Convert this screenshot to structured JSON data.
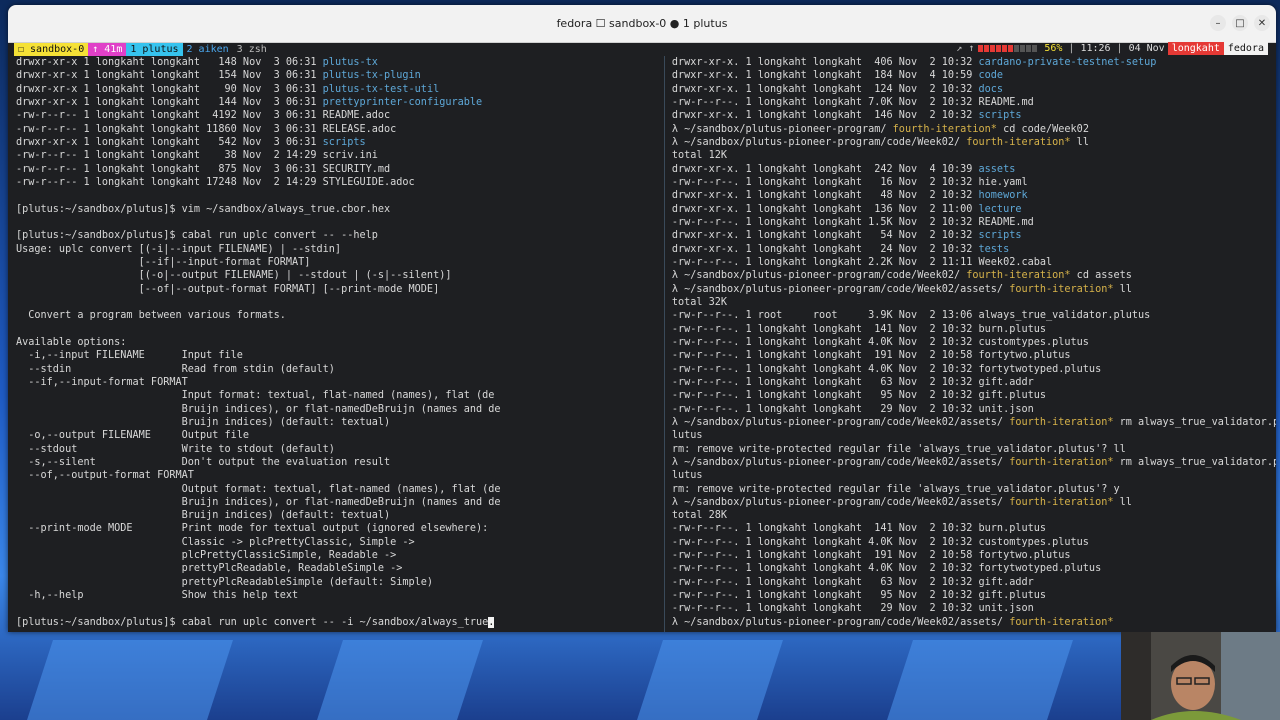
{
  "window": {
    "title": "fedora ☐ sandbox-0 ● 1 plutus",
    "buttons": [
      "–",
      "□",
      "✕"
    ]
  },
  "tmux": {
    "session": "☐ sandbox-0",
    "tabs": [
      {
        "label": "↑ 41m",
        "style": "pink"
      },
      {
        "label": "1 plutus",
        "style": "cyan"
      },
      {
        "label": "2 aiken",
        "style": "blue"
      },
      {
        "label": "3 zsh",
        "style": "gray"
      }
    ],
    "status": {
      "arrows": "↗ ↑",
      "battery": "56%",
      "battery_level": 0.56,
      "time": "11:26",
      "date": "04 Nov",
      "user": "longkaht",
      "host": "fedora"
    }
  },
  "left_pane": {
    "lines": [
      {
        "text": "drwxr-xr-x 1 longkaht longkaht   148 Nov  3 06:31 ",
        "link": "plutus-tx"
      },
      {
        "text": "drwxr-xr-x 1 longkaht longkaht   154 Nov  3 06:31 ",
        "link": "plutus-tx-plugin"
      },
      {
        "text": "drwxr-xr-x 1 longkaht longkaht    90 Nov  3 06:31 ",
        "link": "plutus-tx-test-util"
      },
      {
        "text": "drwxr-xr-x 1 longkaht longkaht   144 Nov  3 06:31 ",
        "link": "prettyprinter-configurable"
      },
      {
        "text": "-rw-r--r-- 1 longkaht longkaht  4192 Nov  3 06:31 README.adoc"
      },
      {
        "text": "-rw-r--r-- 1 longkaht longkaht 11860 Nov  3 06:31 RELEASE.adoc"
      },
      {
        "text": "drwxr-xr-x 1 longkaht longkaht   542 Nov  3 06:31 ",
        "link": "scripts"
      },
      {
        "text": "-rw-r--r-- 1 longkaht longkaht    38 Nov  2 14:29 scriv.ini"
      },
      {
        "text": "-rw-r--r-- 1 longkaht longkaht   875 Nov  3 06:31 SECURITY.md"
      },
      {
        "text": "-rw-r--r-- 1 longkaht longkaht 17248 Nov  2 14:29 STYLEGUIDE.adoc"
      },
      {
        "text": ""
      },
      {
        "text": "[plutus:~/sandbox/plutus]$ vim ~/sandbox/always_true.cbor.hex"
      },
      {
        "text": ""
      },
      {
        "text": "[plutus:~/sandbox/plutus]$ cabal run uplc convert -- --help"
      },
      {
        "text": "Usage: uplc convert [(-i|--input FILENAME) | --stdin]"
      },
      {
        "text": "                    [--if|--input-format FORMAT]"
      },
      {
        "text": "                    [(-o|--output FILENAME) | --stdout | (-s|--silent)]"
      },
      {
        "text": "                    [--of|--output-format FORMAT] [--print-mode MODE]"
      },
      {
        "text": ""
      },
      {
        "text": "  Convert a program between various formats."
      },
      {
        "text": ""
      },
      {
        "text": "Available options:"
      },
      {
        "text": "  -i,--input FILENAME      Input file"
      },
      {
        "text": "  --stdin                  Read from stdin (default)"
      },
      {
        "text": "  --if,--input-format FORMAT"
      },
      {
        "text": "                           Input format: textual, flat-named (names), flat (de"
      },
      {
        "text": "                           Bruijn indices), or flat-namedDeBruijn (names and de"
      },
      {
        "text": "                           Bruijn indices) (default: textual)"
      },
      {
        "text": "  -o,--output FILENAME     Output file"
      },
      {
        "text": "  --stdout                 Write to stdout (default)"
      },
      {
        "text": "  -s,--silent              Don't output the evaluation result"
      },
      {
        "text": "  --of,--output-format FORMAT"
      },
      {
        "text": "                           Output format: textual, flat-named (names), flat (de"
      },
      {
        "text": "                           Bruijn indices), or flat-namedDeBruijn (names and de"
      },
      {
        "text": "                           Bruijn indices) (default: textual)"
      },
      {
        "text": "  --print-mode MODE        Print mode for textual output (ignored elsewhere):"
      },
      {
        "text": "                           Classic -> plcPrettyClassic, Simple ->"
      },
      {
        "text": "                           plcPrettyClassicSimple, Readable ->"
      },
      {
        "text": "                           prettyPlcReadable, ReadableSimple ->"
      },
      {
        "text": "                           prettyPlcReadableSimple (default: Simple)"
      },
      {
        "text": "  -h,--help                Show this help text"
      },
      {
        "text": ""
      },
      {
        "text": "[plutus:~/sandbox/plutus]$ cabal run uplc convert -- -i ~/sandbox/always_true",
        "cursor": "."
      }
    ]
  },
  "right_pane": {
    "lines": [
      {
        "text": "drwxr-xr-x. 1 longkaht longkaht  406 Nov  2 10:32 ",
        "link": "cardano-private-testnet-setup"
      },
      {
        "text": "drwxr-xr-x. 1 longkaht longkaht  184 Nov  4 10:59 ",
        "link": "code"
      },
      {
        "text": "drwxr-xr-x. 1 longkaht longkaht  124 Nov  2 10:32 ",
        "link": "docs"
      },
      {
        "text": "-rw-r--r--. 1 longkaht longkaht 7.0K Nov  2 10:32 README.md"
      },
      {
        "text": "drwxr-xr-x. 1 longkaht longkaht  146 Nov  2 10:32 ",
        "link": "scripts"
      },
      {
        "prompt": "λ ~/sandbox/plutus-pioneer-program/ ",
        "branch": "fourth-iteration*",
        "cmd": " cd code/Week02"
      },
      {
        "prompt": "λ ~/sandbox/plutus-pioneer-program/code/Week02/ ",
        "branch": "fourth-iteration*",
        "cmd": " ll"
      },
      {
        "text": "total 12K"
      },
      {
        "text": "drwxr-xr-x. 1 longkaht longkaht  242 Nov  4 10:39 ",
        "link": "assets"
      },
      {
        "text": "-rw-r--r--. 1 longkaht longkaht   16 Nov  2 10:32 hie.yaml"
      },
      {
        "text": "drwxr-xr-x. 1 longkaht longkaht   48 Nov  2 10:32 ",
        "link": "homework"
      },
      {
        "text": "drwxr-xr-x. 1 longkaht longkaht  136 Nov  2 11:00 ",
        "link": "lecture"
      },
      {
        "text": "-rw-r--r--. 1 longkaht longkaht 1.5K Nov  2 10:32 README.md"
      },
      {
        "text": "drwxr-xr-x. 1 longkaht longkaht   54 Nov  2 10:32 ",
        "link": "scripts"
      },
      {
        "text": "drwxr-xr-x. 1 longkaht longkaht   24 Nov  2 10:32 ",
        "link": "tests"
      },
      {
        "text": "-rw-r--r--. 1 longkaht longkaht 2.2K Nov  2 11:11 Week02.cabal"
      },
      {
        "prompt": "λ ~/sandbox/plutus-pioneer-program/code/Week02/ ",
        "branch": "fourth-iteration*",
        "cmd": " cd assets"
      },
      {
        "prompt": "λ ~/sandbox/plutus-pioneer-program/code/Week02/assets/ ",
        "branch": "fourth-iteration*",
        "cmd": " ll"
      },
      {
        "text": "total 32K"
      },
      {
        "text": "-rw-r--r--. 1 root     root     3.9K Nov  2 13:06 always_true_validator.plutus"
      },
      {
        "text": "-rw-r--r--. 1 longkaht longkaht  141 Nov  2 10:32 burn.plutus"
      },
      {
        "text": "-rw-r--r--. 1 longkaht longkaht 4.0K Nov  2 10:32 customtypes.plutus"
      },
      {
        "text": "-rw-r--r--. 1 longkaht longkaht  191 Nov  2 10:58 fortytwo.plutus"
      },
      {
        "text": "-rw-r--r--. 1 longkaht longkaht 4.0K Nov  2 10:32 fortytwotyped.plutus"
      },
      {
        "text": "-rw-r--r--. 1 longkaht longkaht   63 Nov  2 10:32 gift.addr"
      },
      {
        "text": "-rw-r--r--. 1 longkaht longkaht   95 Nov  2 10:32 gift.plutus"
      },
      {
        "text": "-rw-r--r--. 1 longkaht longkaht   29 Nov  2 10:32 unit.json"
      },
      {
        "prompt": "λ ~/sandbox/plutus-pioneer-program/code/Week02/assets/ ",
        "branch": "fourth-iteration*",
        "cmd": " rm always_true_validator.p"
      },
      {
        "text": "lutus"
      },
      {
        "text": "rm: remove write-protected regular file 'always_true_validator.plutus'? ll"
      },
      {
        "prompt": "λ ~/sandbox/plutus-pioneer-program/code/Week02/assets/ ",
        "branch": "fourth-iteration*",
        "cmd": " rm always_true_validator.p"
      },
      {
        "text": "lutus"
      },
      {
        "text": "rm: remove write-protected regular file 'always_true_validator.plutus'? y"
      },
      {
        "prompt": "λ ~/sandbox/plutus-pioneer-program/code/Week02/assets/ ",
        "branch": "fourth-iteration*",
        "cmd": " ll"
      },
      {
        "text": "total 28K"
      },
      {
        "text": "-rw-r--r--. 1 longkaht longkaht  141 Nov  2 10:32 burn.plutus"
      },
      {
        "text": "-rw-r--r--. 1 longkaht longkaht 4.0K Nov  2 10:32 customtypes.plutus"
      },
      {
        "text": "-rw-r--r--. 1 longkaht longkaht  191 Nov  2 10:58 fortytwo.plutus"
      },
      {
        "text": "-rw-r--r--. 1 longkaht longkaht 4.0K Nov  2 10:32 fortytwotyped.plutus"
      },
      {
        "text": "-rw-r--r--. 1 longkaht longkaht   63 Nov  2 10:32 gift.addr"
      },
      {
        "text": "-rw-r--r--. 1 longkaht longkaht   95 Nov  2 10:32 gift.plutus"
      },
      {
        "text": "-rw-r--r--. 1 longkaht longkaht   29 Nov  2 10:32 unit.json"
      },
      {
        "prompt": "λ ~/sandbox/plutus-pioneer-program/code/Week02/assets/ ",
        "branch": "fourth-iteration*",
        "cmd": ""
      }
    ]
  },
  "colors": {
    "terminal_bg": "#1e1f22",
    "dir_blue": "#5ea8d8",
    "branch_yellow": "#d6b24a",
    "tmux_yellow": "#f5e136",
    "tmux_pink": "#e040c8",
    "tmux_cyan": "#36c3ee",
    "status_red": "#e53935"
  }
}
